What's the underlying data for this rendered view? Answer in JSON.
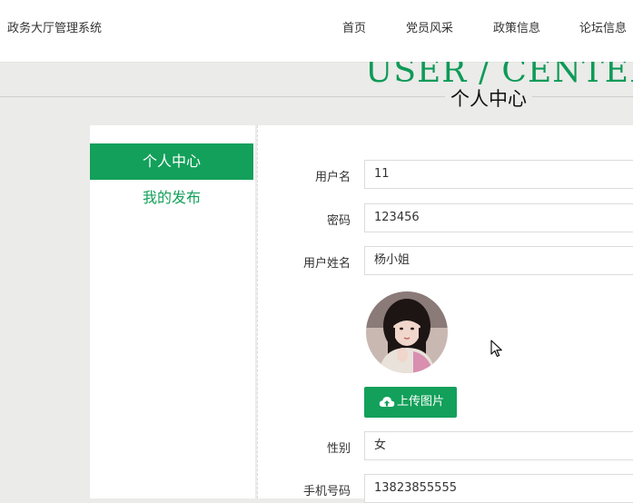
{
  "header": {
    "app_title": "政务大厅管理系统",
    "nav": [
      "首页",
      "党员风采",
      "政策信息",
      "论坛信息"
    ]
  },
  "banner": {
    "title_en": "USER / CENTER",
    "title_cn": "个人中心"
  },
  "sidebar": {
    "items": [
      {
        "label": "个人中心",
        "active": true
      },
      {
        "label": "我的发布",
        "active": false
      }
    ]
  },
  "form": {
    "username_label": "用户名",
    "username_value": "11",
    "password_label": "密码",
    "password_value": "123456",
    "realname_label": "用户姓名",
    "realname_value": "杨小姐",
    "upload_label": "上传图片",
    "gender_label": "性别",
    "gender_value": "女",
    "phone_label": "手机号码",
    "phone_value": "13823855555"
  },
  "colors": {
    "accent": "#13a05a",
    "page_bg": "#ebebe9"
  },
  "icons": [
    "cloud-upload-icon",
    "mouse-cursor-icon"
  ]
}
